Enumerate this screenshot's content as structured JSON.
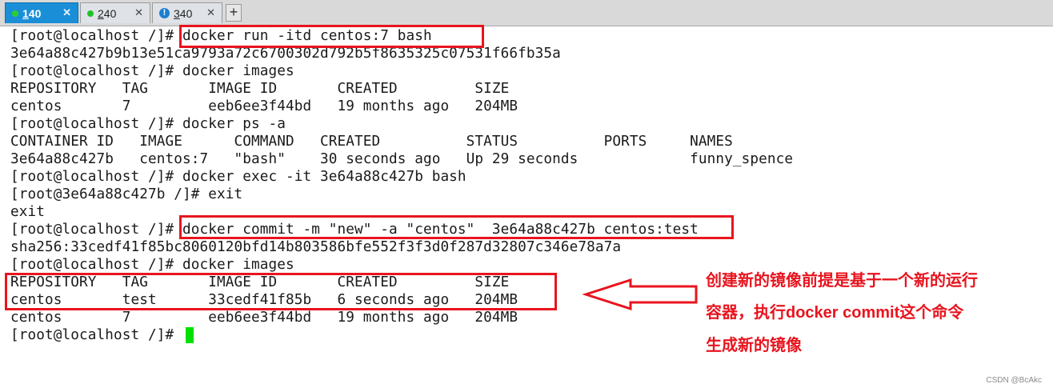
{
  "tabs": [
    {
      "index": "1",
      "label": " 40",
      "status": "connected"
    },
    {
      "index": "2",
      "label": " 40",
      "status": "connected"
    },
    {
      "index": "3",
      "label": " 40",
      "status": "warning"
    }
  ],
  "tab_close_symbol": "✕",
  "new_tab_symbol": "+",
  "status_icon_text": "!",
  "terminal": {
    "lines": [
      "[root@localhost /]# docker run -itd centos:7 bash",
      "3e64a88c427b9b13e51ca9793a72c6700302d792b5f8635325c07531f66fb35a",
      "[root@localhost /]# docker images",
      "REPOSITORY   TAG       IMAGE ID       CREATED         SIZE",
      "centos       7         eeb6ee3f44bd   19 months ago   204MB",
      "[root@localhost /]# docker ps -a",
      "CONTAINER ID   IMAGE      COMMAND   CREATED          STATUS          PORTS     NAMES",
      "3e64a88c427b   centos:7   \"bash\"    30 seconds ago   Up 29 seconds             funny_spence",
      "[root@localhost /]# docker exec -it 3e64a88c427b bash",
      "[root@3e64a88c427b /]# exit",
      "exit",
      "[root@localhost /]# docker commit -m \"new\" -a \"centos\"  3e64a88c427b centos:test",
      "sha256:33cedf41f85bc8060120bfd14b803586bfe552f3f3d0f287d32807c346e78a7a",
      "[root@localhost /]# docker images",
      "REPOSITORY   TAG       IMAGE ID       CREATED         SIZE",
      "centos       test      33cedf41f85b   6 seconds ago   204MB",
      "centos       7         eeb6ee3f44bd   19 months ago   204MB",
      "[root@localhost /]# "
    ]
  },
  "annotation": {
    "lines": [
      "创建新的镜像前提是基于一个新的运行",
      "容器，执行docker commit这个命令",
      "生成新的镜像"
    ]
  },
  "watermark": "CSDN @BcAkc",
  "colors": {
    "active_tab": "#1a8fd8",
    "annotation_red": "#e8141e",
    "cursor": "#00e000",
    "connected_dot": "#22c02a"
  }
}
